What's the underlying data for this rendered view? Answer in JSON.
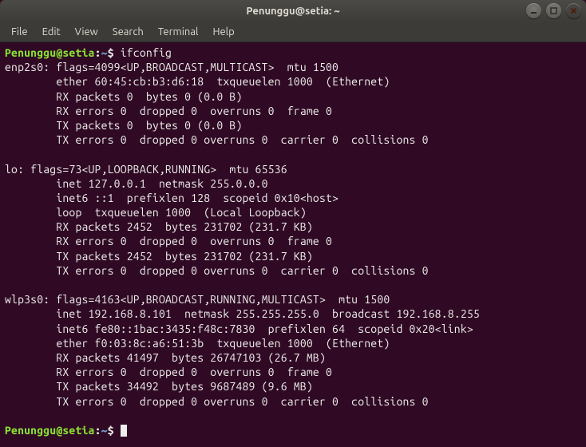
{
  "window": {
    "title": "Penunggu@setia: ~"
  },
  "menubar": {
    "items": [
      "File",
      "Edit",
      "View",
      "Search",
      "Terminal",
      "Help"
    ]
  },
  "prompt": {
    "user_host": "Penunggu@setia",
    "colon": ":",
    "path": "~",
    "sigil": "$"
  },
  "command": "ifconfig",
  "interfaces": [
    {
      "name": "enp2s0",
      "lines": [
        "enp2s0: flags=4099<UP,BROADCAST,MULTICAST>  mtu 1500",
        "        ether 60:45:cb:b3:d6:18  txqueuelen 1000  (Ethernet)",
        "        RX packets 0  bytes 0 (0.0 B)",
        "        RX errors 0  dropped 0  overruns 0  frame 0",
        "        TX packets 0  bytes 0 (0.0 B)",
        "        TX errors 0  dropped 0 overruns 0  carrier 0  collisions 0"
      ]
    },
    {
      "name": "lo",
      "lines": [
        "lo: flags=73<UP,LOOPBACK,RUNNING>  mtu 65536",
        "        inet 127.0.0.1  netmask 255.0.0.0",
        "        inet6 ::1  prefixlen 128  scopeid 0x10<host>",
        "        loop  txqueuelen 1000  (Local Loopback)",
        "        RX packets 2452  bytes 231702 (231.7 KB)",
        "        RX errors 0  dropped 0  overruns 0  frame 0",
        "        TX packets 2452  bytes 231702 (231.7 KB)",
        "        TX errors 0  dropped 0 overruns 0  carrier 0  collisions 0"
      ]
    },
    {
      "name": "wlp3s0",
      "lines": [
        "wlp3s0: flags=4163<UP,BROADCAST,RUNNING,MULTICAST>  mtu 1500",
        "        inet 192.168.8.101  netmask 255.255.255.0  broadcast 192.168.8.255",
        "        inet6 fe80::1bac:3435:f48c:7830  prefixlen 64  scopeid 0x20<link>",
        "        ether f0:03:8c:a6:51:3b  txqueuelen 1000  (Ethernet)",
        "        RX packets 41497  bytes 26747103 (26.7 MB)",
        "        RX errors 0  dropped 0  overruns 0  frame 0",
        "        TX packets 34492  bytes 9687489 (9.6 MB)",
        "        TX errors 0  dropped 0 overruns 0  carrier 0  collisions 0"
      ]
    }
  ]
}
